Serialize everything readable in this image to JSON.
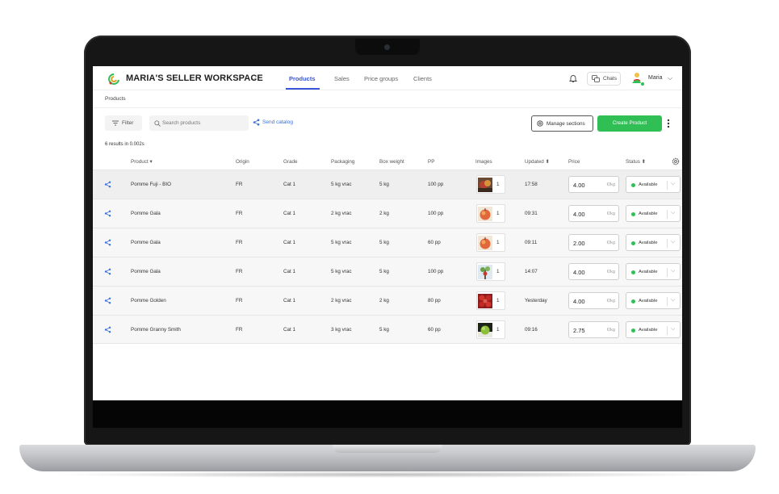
{
  "app": {
    "workspace_title": "MARIA'S SELLER WORKSPACE",
    "tabs": [
      {
        "label": "Products",
        "active": true
      },
      {
        "label": "Sales",
        "active": false
      },
      {
        "label": "Price groups",
        "active": false
      },
      {
        "label": "Clients",
        "active": false
      }
    ],
    "chats_label": "Chats",
    "user_name": "Maria",
    "accent_color": "#3a55d8",
    "success_color": "#2fbf55"
  },
  "breadcrumb": "Products",
  "toolbar": {
    "filter_label": "Filter",
    "search_placeholder": "Search products",
    "send_catalog_label": "Send catalog",
    "manage_sections_label": "Manage sections",
    "create_product_label": "Create Product"
  },
  "results_text": "6 results in 0.002s",
  "table": {
    "headers": {
      "product": "Product ▾",
      "origin": "Origin",
      "grade": "Grade",
      "packaging": "Packaging",
      "box_weight": "Box weight",
      "pp": "PP",
      "images": "Images",
      "updated": "Updated ⬍",
      "price": "Price",
      "status": "Status ⬍"
    },
    "price_unit": "€/kg",
    "rows": [
      {
        "product": "Pomme Fuji - BIO",
        "origin": "FR",
        "grade": "Cat 1",
        "packaging": "5 kg vrac",
        "box_weight": "5 kg",
        "pp": "100 pp",
        "images": "1",
        "updated": "17:58",
        "price": "4.00",
        "status": "Available",
        "thumb": "fuji-apple-icon"
      },
      {
        "product": "Pomme Gala",
        "origin": "FR",
        "grade": "Cat 1",
        "packaging": "2 kg vrac",
        "box_weight": "2 kg",
        "pp": "100 pp",
        "images": "1",
        "updated": "09:31",
        "price": "4.00",
        "status": "Available",
        "thumb": "gala-apple-icon"
      },
      {
        "product": "Pomme Gala",
        "origin": "FR",
        "grade": "Cat 1",
        "packaging": "5 kg vrac",
        "box_weight": "5 kg",
        "pp": "60 pp",
        "images": "1",
        "updated": "09:11",
        "price": "2.00",
        "status": "Available",
        "thumb": "gala-apple-icon"
      },
      {
        "product": "Pomme Gala",
        "origin": "FR",
        "grade": "Cat 1",
        "packaging": "5 kg vrac",
        "box_weight": "5 kg",
        "pp": "100 pp",
        "images": "1",
        "updated": "14:07",
        "price": "4.00",
        "status": "Available",
        "thumb": "apple-tree-icon"
      },
      {
        "product": "Pomme Golden",
        "origin": "FR",
        "grade": "Cat 1",
        "packaging": "2 kg vrac",
        "box_weight": "2 kg",
        "pp": "80 pp",
        "images": "1",
        "updated": "Yesterday",
        "price": "4.00",
        "status": "Available",
        "thumb": "red-apples-icon"
      },
      {
        "product": "Pomme Granny Smith",
        "origin": "FR",
        "grade": "Cat 1",
        "packaging": "3 kg vrac",
        "box_weight": "5 kg",
        "pp": "60 pp",
        "images": "1",
        "updated": "09:16",
        "price": "2.75",
        "status": "Available",
        "thumb": "green-apple-icon"
      }
    ]
  }
}
